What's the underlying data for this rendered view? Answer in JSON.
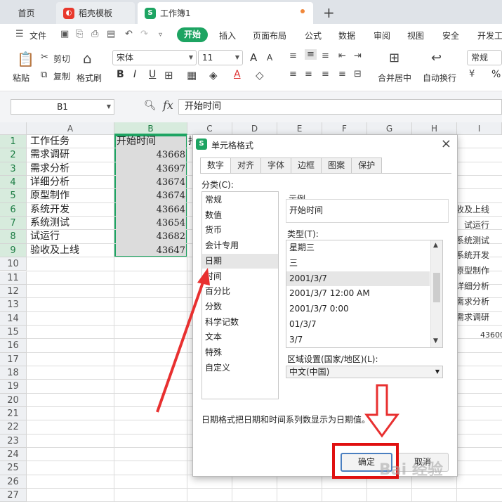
{
  "tabs": {
    "home": "首页",
    "docer": "稻壳模板",
    "workbook": "工作簿1",
    "add": "+"
  },
  "menu": {
    "file": "文件",
    "items": [
      "开始",
      "插入",
      "页面布局",
      "公式",
      "数据",
      "审阅",
      "视图",
      "安全",
      "开发工"
    ]
  },
  "ribbon": {
    "paste": "粘贴",
    "cut": "剪切",
    "copy": "复制",
    "format_painter": "格式刷",
    "font_name": "宋体",
    "font_size": "11",
    "bold": "B",
    "italic": "I",
    "underline": "U",
    "font_color_glyph": "A",
    "grow_font": "A",
    "shrink_font": "A",
    "merge_center": "合并居中",
    "wrap_text": "自动换行",
    "number_format": "常规",
    "percent": "%"
  },
  "formula_bar": {
    "name_box": "B1",
    "fx": "fx",
    "content": "开始时间"
  },
  "grid": {
    "columns": [
      "A",
      "B",
      "C",
      "D",
      "E",
      "F",
      "G",
      "H",
      "I"
    ],
    "rows": [
      "1",
      "2",
      "3",
      "4",
      "5",
      "6",
      "7",
      "8",
      "9",
      "10",
      "11",
      "12",
      "13",
      "14",
      "15",
      "16",
      "17",
      "18",
      "19",
      "20",
      "21",
      "22",
      "23",
      "24",
      "25",
      "26",
      "27"
    ],
    "col_a": [
      "工作任务",
      "需求调研",
      "需求分析",
      "详细分析",
      "原型制作",
      "系统开发",
      "系统测试",
      "试运行",
      "验收及上线"
    ],
    "col_b": [
      "开始时间",
      "43668",
      "43697",
      "43674",
      "43674",
      "43664",
      "43654",
      "43682",
      "43647"
    ],
    "c1_partial": "持",
    "behind_chart_labels": [
      "验收及上线",
      "试运行",
      "系统测试",
      "系统开发",
      "原型制作",
      "详细分析",
      "需求分析",
      "需求调研"
    ],
    "behind_chart_axis": "43600"
  },
  "dialog": {
    "title": "单元格格式",
    "close": "×",
    "tabs": [
      "数字",
      "对齐",
      "字体",
      "边框",
      "图案",
      "保护"
    ],
    "category_label": "分类(C):",
    "categories": [
      "常规",
      "数值",
      "货币",
      "会计专用",
      "日期",
      "时间",
      "百分比",
      "分数",
      "科学记数",
      "文本",
      "特殊",
      "自定义"
    ],
    "selected_category": "日期",
    "sample_label": "示例",
    "sample_value": "开始时间",
    "type_label": "类型(T):",
    "types": [
      "星期三",
      "三",
      "2001/3/7",
      "2001/3/7 12:00 AM",
      "2001/3/7 0:00",
      "01/3/7",
      "3/7"
    ],
    "selected_type": "2001/3/7",
    "region_label": "区域设置(国家/地区)(L):",
    "region_value": "中文(中国)",
    "description": "日期格式把日期和时间系列数显示为日期值。",
    "ok": "确定",
    "cancel": "取消"
  },
  "watermark": "Bai 经验",
  "colors": {
    "accent": "#1da462",
    "annotation": "#e01010"
  }
}
